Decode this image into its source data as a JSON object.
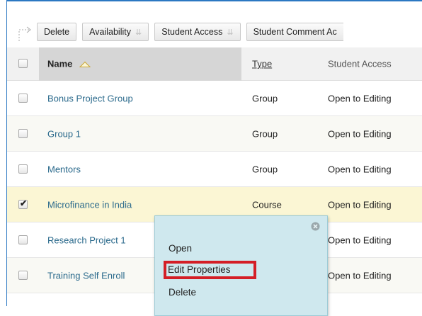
{
  "toolbar": {
    "buttons": [
      {
        "label": "Delete",
        "has_menu": false
      },
      {
        "label": "Availability",
        "has_menu": true
      },
      {
        "label": "Student Access",
        "has_menu": true
      },
      {
        "label": "Student Comment Ac",
        "has_menu": false
      }
    ]
  },
  "table": {
    "headers": {
      "name": "Name",
      "type": "Type",
      "access": "Student Access"
    },
    "sort": {
      "column": "name",
      "direction": "ascending"
    },
    "rows": [
      {
        "name": "Bonus Project Group",
        "type": "Group",
        "access": "Open to Editing",
        "checked": false
      },
      {
        "name": "Group 1",
        "type": "Group",
        "access": "Open to Editing",
        "checked": false
      },
      {
        "name": "Mentors",
        "type": "Group",
        "access": "Open to Editing",
        "checked": false
      },
      {
        "name": "Microfinance in India",
        "type": "Course",
        "access": "Open to Editing",
        "checked": true
      },
      {
        "name": "Research Project 1",
        "type": "",
        "access": "Open to Editing",
        "checked": false
      },
      {
        "name": "Training Self Enroll",
        "type": "",
        "access": "Open to Editing",
        "checked": false
      }
    ]
  },
  "context_menu": {
    "items": [
      "Open",
      "Edit Properties",
      "Delete"
    ],
    "highlighted": "Edit Properties"
  },
  "colors": {
    "frame": "#2b78c2",
    "link": "#2b6a8c",
    "selected_row": "#fbf6d4",
    "menu_bg": "#cfe8ee",
    "highlight_border": "#d41e26"
  }
}
